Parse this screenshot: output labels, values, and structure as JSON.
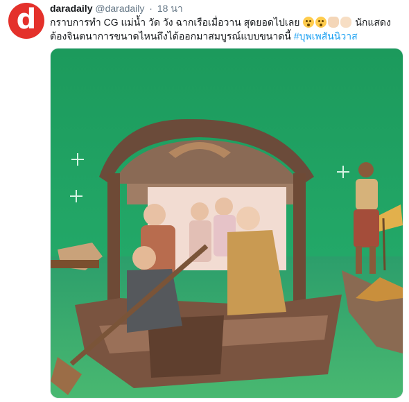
{
  "tweet": {
    "author_name": "daradaily",
    "handle": "@daradaily",
    "separator": "·",
    "time": "18 นา",
    "text_part1": "กราบการทำ CG แม่น้ำ วัด วัง ฉากเรือเมื่อวาน สุดยอดไปเลย",
    "text_part2": "นักแสดงต้องจินตนาการขนาดไหนถึงได้ออกมาสมบูรณ์แบบขนาดนี้",
    "hashtag": "#บุพเพสันนิวาส",
    "avatar_letter": "d"
  },
  "colors": {
    "avatar_red": "#e4312b",
    "hashtag_blue": "#1da1f2",
    "greenscreen": "#1f9e62"
  }
}
